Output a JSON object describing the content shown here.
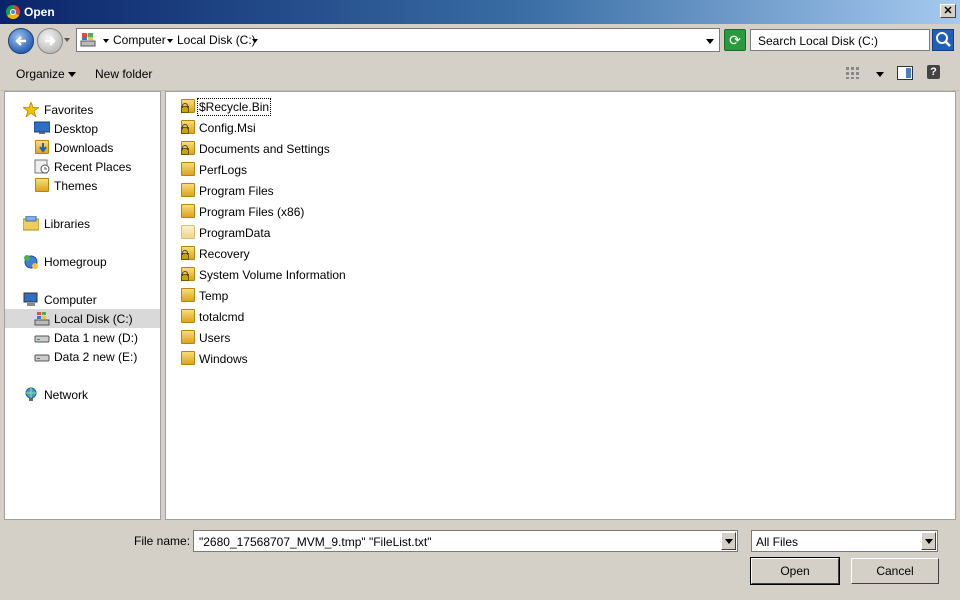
{
  "window": {
    "title": "Open",
    "close_glyph": "✕"
  },
  "address": {
    "crumbs": [
      "Computer",
      "Local Disk (C:)"
    ],
    "search_placeholder": "Search Local Disk (C:)"
  },
  "toolbar": {
    "organize_label": "Organize",
    "new_folder_label": "New folder",
    "help_glyph": "?"
  },
  "nav": {
    "favorites": {
      "label": "Favorites",
      "items": [
        "Desktop",
        "Downloads",
        "Recent Places",
        "Themes"
      ]
    },
    "libraries": {
      "label": "Libraries"
    },
    "homegroup": {
      "label": "Homegroup"
    },
    "computer": {
      "label": "Computer",
      "items": [
        "Local Disk (C:)",
        "Data 1 new (D:)",
        "Data 2 new (E:)"
      ],
      "selected_index": 0
    },
    "network": {
      "label": "Network"
    }
  },
  "files": [
    {
      "name": "$Recycle.Bin",
      "locked": true,
      "focused": true
    },
    {
      "name": "Config.Msi",
      "locked": true
    },
    {
      "name": "Documents and Settings",
      "locked": true
    },
    {
      "name": "PerfLogs",
      "locked": false
    },
    {
      "name": "Program Files",
      "locked": false
    },
    {
      "name": "Program Files (x86)",
      "locked": false
    },
    {
      "name": "ProgramData",
      "locked": false,
      "hidden": true
    },
    {
      "name": "Recovery",
      "locked": true
    },
    {
      "name": "System Volume Information",
      "locked": true
    },
    {
      "name": "Temp",
      "locked": false
    },
    {
      "name": "totalcmd",
      "locked": false
    },
    {
      "name": "Users",
      "locked": false
    },
    {
      "name": "Windows",
      "locked": false
    }
  ],
  "bottom": {
    "filename_label": "File name:",
    "filename_value": "\"2680_17568707_MVM_9.tmp\" \"FileList.txt\"",
    "filter_value": "All Files",
    "open_label": "Open",
    "cancel_label": "Cancel"
  }
}
